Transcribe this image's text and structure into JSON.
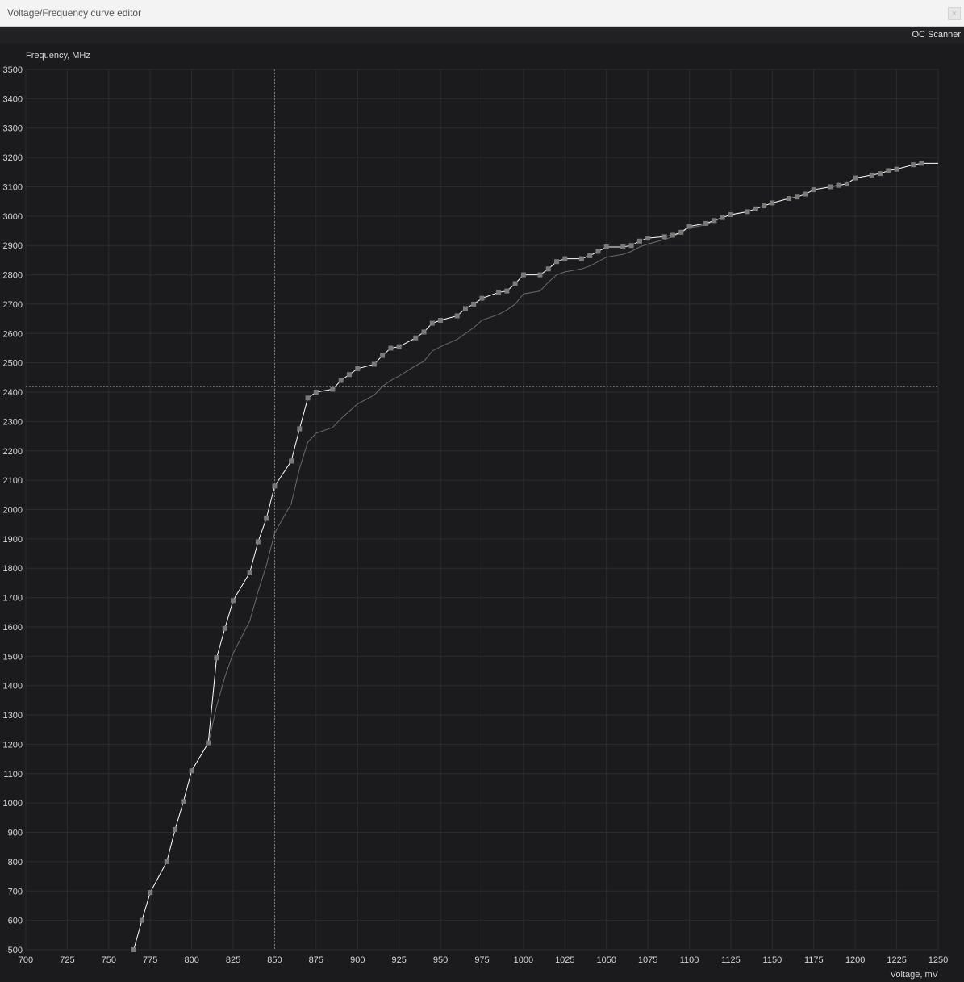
{
  "window": {
    "title": "Voltage/Frequency curve editor",
    "close_label": "×"
  },
  "toolbar": {
    "oc_scanner_label": "OC Scanner"
  },
  "colors": {
    "background": "#1b1b1d",
    "grid": "#2c2c2f",
    "curve": "#ffffff",
    "curve_points": "#7a7a7a",
    "baseline_curve": "#6a6a6a",
    "crosshair": "#7d7d7d"
  },
  "chart_data": {
    "type": "line",
    "ylabel": "Frequency, MHz",
    "xlabel": "Voltage, mV",
    "xlim": [
      700,
      1250
    ],
    "ylim": [
      500,
      3500
    ],
    "xticks": [
      700,
      725,
      750,
      775,
      800,
      825,
      850,
      875,
      900,
      925,
      950,
      975,
      1000,
      1025,
      1050,
      1075,
      1100,
      1125,
      1150,
      1175,
      1200,
      1225,
      1250
    ],
    "yticks": [
      500,
      600,
      700,
      800,
      900,
      1000,
      1100,
      1200,
      1300,
      1400,
      1500,
      1600,
      1700,
      1800,
      1900,
      2000,
      2100,
      2200,
      2300,
      2400,
      2500,
      2600,
      2700,
      2800,
      2900,
      3000,
      3100,
      3200,
      3300,
      3400,
      3500
    ],
    "grid": true,
    "crosshair": {
      "x": 850,
      "y": 2420
    },
    "series": [
      {
        "role": "edited",
        "markers": true,
        "points": [
          [
            765,
            500
          ],
          [
            770,
            600
          ],
          [
            775,
            695
          ],
          [
            785,
            800
          ],
          [
            790,
            910
          ],
          [
            795,
            1005
          ],
          [
            800,
            1110
          ],
          [
            810,
            1205
          ],
          [
            815,
            1495
          ],
          [
            820,
            1595
          ],
          [
            825,
            1690
          ],
          [
            835,
            1785
          ],
          [
            840,
            1890
          ],
          [
            845,
            1970
          ],
          [
            850,
            2080
          ],
          [
            860,
            2165
          ],
          [
            865,
            2275
          ],
          [
            870,
            2380
          ],
          [
            875,
            2400
          ],
          [
            885,
            2410
          ],
          [
            890,
            2440
          ],
          [
            895,
            2460
          ],
          [
            900,
            2480
          ],
          [
            910,
            2495
          ],
          [
            915,
            2525
          ],
          [
            920,
            2550
          ],
          [
            925,
            2555
          ],
          [
            935,
            2585
          ],
          [
            940,
            2605
          ],
          [
            945,
            2635
          ],
          [
            950,
            2645
          ],
          [
            960,
            2660
          ],
          [
            965,
            2685
          ],
          [
            970,
            2700
          ],
          [
            975,
            2720
          ],
          [
            985,
            2740
          ],
          [
            990,
            2745
          ],
          [
            995,
            2770
          ],
          [
            1000,
            2800
          ],
          [
            1010,
            2800
          ],
          [
            1015,
            2820
          ],
          [
            1020,
            2845
          ],
          [
            1025,
            2855
          ],
          [
            1035,
            2855
          ],
          [
            1040,
            2865
          ],
          [
            1045,
            2880
          ],
          [
            1050,
            2895
          ],
          [
            1060,
            2895
          ],
          [
            1065,
            2900
          ],
          [
            1070,
            2915
          ],
          [
            1075,
            2925
          ],
          [
            1085,
            2930
          ],
          [
            1090,
            2935
          ],
          [
            1095,
            2945
          ],
          [
            1100,
            2965
          ],
          [
            1110,
            2975
          ],
          [
            1115,
            2985
          ],
          [
            1120,
            2995
          ],
          [
            1125,
            3005
          ],
          [
            1135,
            3015
          ],
          [
            1140,
            3025
          ],
          [
            1145,
            3035
          ],
          [
            1150,
            3045
          ],
          [
            1160,
            3060
          ],
          [
            1165,
            3065
          ],
          [
            1170,
            3075
          ],
          [
            1175,
            3090
          ],
          [
            1185,
            3100
          ],
          [
            1190,
            3105
          ],
          [
            1195,
            3110
          ],
          [
            1200,
            3130
          ],
          [
            1210,
            3140
          ],
          [
            1215,
            3145
          ],
          [
            1220,
            3155
          ],
          [
            1225,
            3160
          ],
          [
            1235,
            3175
          ],
          [
            1240,
            3180
          ],
          [
            1250,
            3180
          ]
        ]
      },
      {
        "role": "default",
        "markers": false,
        "points": [
          [
            810,
            1200
          ],
          [
            815,
            1330
          ],
          [
            820,
            1430
          ],
          [
            825,
            1510
          ],
          [
            835,
            1620
          ],
          [
            840,
            1720
          ],
          [
            845,
            1810
          ],
          [
            850,
            1920
          ],
          [
            860,
            2020
          ],
          [
            865,
            2140
          ],
          [
            870,
            2230
          ],
          [
            875,
            2260
          ],
          [
            885,
            2280
          ],
          [
            890,
            2310
          ],
          [
            900,
            2360
          ],
          [
            910,
            2390
          ],
          [
            915,
            2420
          ],
          [
            920,
            2440
          ],
          [
            925,
            2455
          ],
          [
            935,
            2490
          ],
          [
            940,
            2505
          ],
          [
            945,
            2540
          ],
          [
            950,
            2555
          ],
          [
            960,
            2580
          ],
          [
            965,
            2600
          ],
          [
            970,
            2620
          ],
          [
            975,
            2645
          ],
          [
            985,
            2665
          ],
          [
            990,
            2680
          ],
          [
            995,
            2700
          ],
          [
            1000,
            2735
          ],
          [
            1010,
            2745
          ],
          [
            1015,
            2775
          ],
          [
            1020,
            2800
          ],
          [
            1025,
            2810
          ],
          [
            1035,
            2820
          ],
          [
            1040,
            2830
          ],
          [
            1045,
            2845
          ],
          [
            1050,
            2860
          ],
          [
            1060,
            2870
          ],
          [
            1065,
            2880
          ],
          [
            1070,
            2895
          ],
          [
            1075,
            2905
          ],
          [
            1085,
            2920
          ],
          [
            1090,
            2930
          ],
          [
            1095,
            2945
          ],
          [
            1100,
            2960
          ],
          [
            1110,
            2970
          ],
          [
            1115,
            2985
          ],
          [
            1120,
            2995
          ],
          [
            1125,
            3005
          ],
          [
            1135,
            3015
          ]
        ]
      }
    ]
  }
}
